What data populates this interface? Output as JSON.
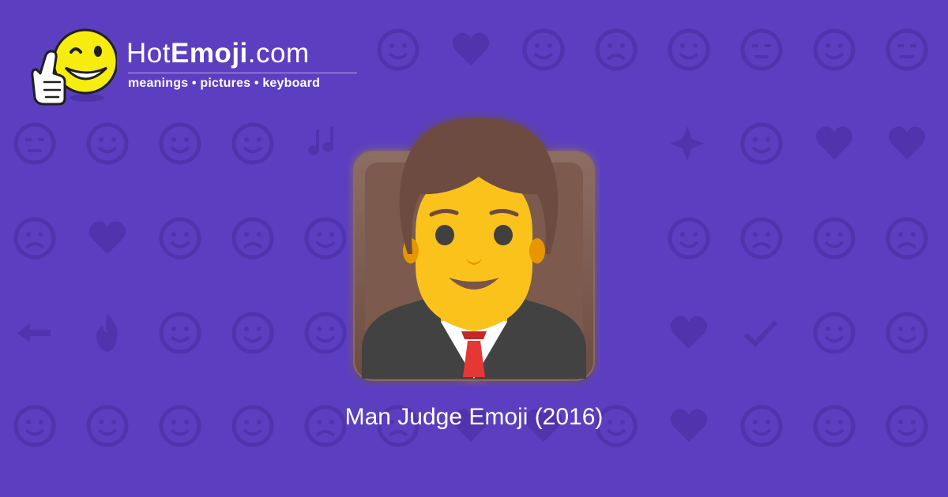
{
  "site": {
    "name_regular_1": "Hot",
    "name_bold": "Emoji",
    "name_regular_2": ".com",
    "tagline": "meanings • pictures • keyboard",
    "logo_icon": "winking-thumbs-up-smiley-icon"
  },
  "emoji": {
    "caption": "Man Judge Emoji (2016)",
    "icon": "man-judge-emoji-icon"
  },
  "colors": {
    "background": "#5b3fc0",
    "pattern": "#4f34ad",
    "caption_text": "#ffffff",
    "skin": "#fcc21b",
    "hair": "#6d4c41",
    "chair": "#795548",
    "robe": "#424242",
    "tie": "#e53935"
  },
  "background_pattern_icons": [
    "heart-eyes-icon",
    "thumbs-up-smiley-icon",
    "winking-face-icon",
    "grinning-face-icon",
    "relieved-face-icon",
    "kissing-face-icon",
    "two-hearts-icon",
    "smiling-face-icon",
    "weary-face-icon",
    "ok-hand-icon",
    "expressionless-face-icon",
    "eyes-icon",
    "smirking-face-icon",
    "relieved-face-icon",
    "drooling-face-icon",
    "recycle-icon",
    "raising-hands-icon",
    "musical-notes-icon",
    "see-no-evil-monkey-icon",
    "sleeping-face-icon",
    "sad-face-icon",
    "grinning-face-icon",
    "sparkles-icon",
    "laughing-face-icon",
    "striped-heart-icon",
    "broken-heart-icon",
    "confused-face-icon",
    "striped-heart-icon",
    "tongue-wink-icon",
    "frowning-face-icon",
    "tears-of-joy-icon",
    "heart-with-arrow-icon",
    "weary-face-icon",
    "revolving-hearts-icon",
    "heart-icon",
    "speak-no-evil-monkey-icon",
    "screaming-face-icon",
    "smiling-imp-icon",
    "angry-face-icon",
    "left-arrow-icon",
    "fire-icon",
    "kiss-icon",
    "grinning-squint-icon",
    "confetti-icon",
    "tongue-squint-icon",
    "rose-icon",
    "sun-icon",
    "flexed-biceps-icon",
    "striped-heart-icon",
    "check-mark-icon",
    "laughing-face-icon",
    "new-moon-face-icon",
    "cat-face-icon",
    "raised-hand-icon",
    "mask-face-icon",
    "camera-icon",
    "sad-face-icon",
    "grimacing-face-icon",
    "striped-heart-icon",
    "beating-heart-icon",
    "kissing-face-icon"
  ]
}
